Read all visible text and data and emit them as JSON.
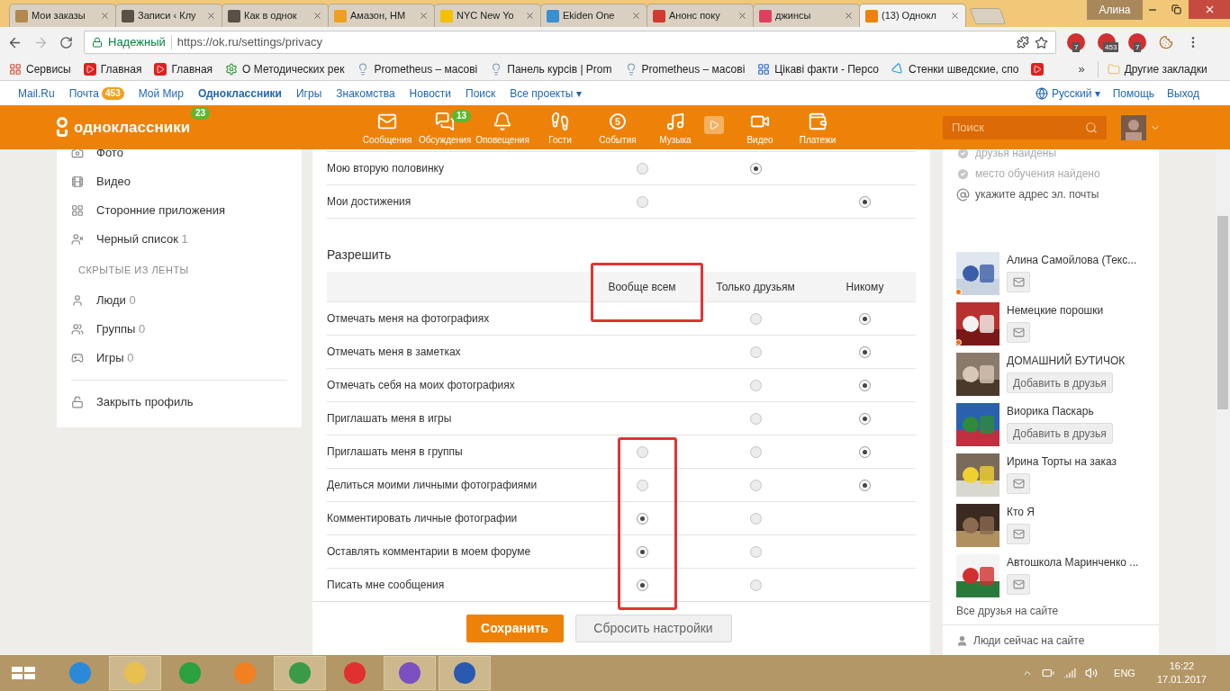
{
  "browser": {
    "tabs": [
      {
        "title": "Мои заказы",
        "selected": false,
        "color": "#b08850"
      },
      {
        "title": "Записи ‹ Клу",
        "selected": false,
        "color": "#5a5048"
      },
      {
        "title": "Как в однок",
        "selected": false,
        "color": "#5a5048"
      },
      {
        "title": "Амазон, НМ",
        "selected": false,
        "color": "#f0a020"
      },
      {
        "title": "NYC New Yo",
        "selected": false,
        "color": "#f5c000"
      },
      {
        "title": "Ekiden One",
        "selected": false,
        "color": "#3a8fd0"
      },
      {
        "title": "Анонс поку",
        "selected": false,
        "color": "#d03a30"
      },
      {
        "title": "джинсы",
        "selected": false,
        "color": "#e04060"
      },
      {
        "title": "(13) Однокл",
        "selected": true,
        "color": "#ee8208"
      }
    ],
    "user": "Алина",
    "secure_label": "Надежный",
    "url": "https://ok.ru/settings/privacy",
    "extension_badges": [
      "7",
      "453",
      "7"
    ],
    "bookmarks": [
      {
        "kind": "apps",
        "label": "Сервисы"
      },
      {
        "kind": "video",
        "label": "Главная"
      },
      {
        "kind": "video",
        "label": "Главная"
      },
      {
        "kind": "gear",
        "label": "О Методических рек"
      },
      {
        "kind": "bulb",
        "label": "Prometheus – масові"
      },
      {
        "kind": "bulb",
        "label": "Панель курсів | Prom"
      },
      {
        "kind": "bulb",
        "label": "Prometheus – масові"
      },
      {
        "kind": "page",
        "label": "Цікаві факти - Персо"
      },
      {
        "kind": "wedge",
        "label": "Стенки шведские, спо"
      }
    ],
    "more": "»",
    "other_bookmarks": "Другие закладки"
  },
  "portal_bar": {
    "items": [
      {
        "label": "Mail.Ru",
        "selected": false
      },
      {
        "label": "Почта",
        "badge": "453",
        "selected": false
      },
      {
        "label": "Мой Мир",
        "selected": false
      },
      {
        "label": "Одноклассники",
        "selected": true
      },
      {
        "label": "Игры",
        "selected": false
      },
      {
        "label": "Знакомства",
        "selected": false
      },
      {
        "label": "Новости",
        "selected": false
      },
      {
        "label": "Поиск",
        "selected": false
      },
      {
        "label": "Все проекты ▾",
        "selected": false
      }
    ],
    "right": [
      "Русский ▾",
      "Помощь",
      "Выход"
    ]
  },
  "header": {
    "logo": "одноклассники",
    "logo_badge": "23",
    "nav": [
      {
        "kind": "mail",
        "label": "Сообщения"
      },
      {
        "kind": "chat",
        "label": "Обсуждения",
        "badge": "13"
      },
      {
        "kind": "bell",
        "label": "Оповещения"
      },
      {
        "kind": "steps",
        "label": "Гости"
      },
      {
        "kind": "events",
        "label": "События",
        "icon_text": "5"
      },
      {
        "kind": "music",
        "label": "Музыка"
      },
      {
        "kind": "camera",
        "label": "Видео"
      },
      {
        "kind": "wallet",
        "label": "Платежи"
      }
    ],
    "search_placeholder": "Поиск"
  },
  "sidebar": {
    "items": [
      {
        "label": "Фото"
      },
      {
        "kind": "video",
        "label": "Видео"
      },
      {
        "kind": "apps",
        "label": "Сторонние приложения"
      },
      {
        "kind": "block",
        "label": "Черный список",
        "count": "1"
      },
      {
        "kind": "heading",
        "label": "СКРЫТЫЕ ИЗ ЛЕНТЫ"
      },
      {
        "kind": "people",
        "label": "Люди",
        "count": "0"
      },
      {
        "kind": "groups",
        "label": "Группы",
        "count": "0"
      },
      {
        "kind": "games",
        "label": "Игры",
        "count": "0"
      },
      {
        "kind": "lock",
        "label": "Закрыть профиль"
      }
    ]
  },
  "show_table": {
    "rows": [
      {
        "label": "Мою вторую половинку",
        "options": [
          {
            "kind": "radio",
            "selected": false
          },
          {
            "kind": "radio",
            "selected": true
          },
          {
            "kind": "empty"
          }
        ]
      },
      {
        "label": "Мои достижения",
        "options": [
          {
            "kind": "radio",
            "selected": false
          },
          {
            "kind": "empty"
          },
          {
            "kind": "radio",
            "selected": true
          }
        ]
      }
    ]
  },
  "allow": {
    "title": "Разрешить",
    "columns": [
      "Вообще всем",
      "Только друзьям",
      "Никому"
    ],
    "rows": [
      {
        "label": "Отмечать меня на фотографиях",
        "options": [
          {
            "kind": "empty"
          },
          {
            "kind": "radio",
            "selected": false
          },
          {
            "kind": "radio",
            "selected": true
          }
        ]
      },
      {
        "label": "Отмечать меня в заметках",
        "options": [
          {
            "kind": "empty"
          },
          {
            "kind": "radio",
            "selected": false
          },
          {
            "kind": "radio",
            "selected": true
          }
        ]
      },
      {
        "label": "Отмечать себя на моих фотографиях",
        "options": [
          {
            "kind": "empty"
          },
          {
            "kind": "radio",
            "selected": false
          },
          {
            "kind": "radio",
            "selected": true
          }
        ]
      },
      {
        "label": "Приглашать меня в игры",
        "options": [
          {
            "kind": "empty"
          },
          {
            "kind": "radio",
            "selected": false
          },
          {
            "kind": "radio",
            "selected": true
          }
        ]
      },
      {
        "label": "Приглашать меня в группы",
        "options": [
          {
            "kind": "radio",
            "selected": false
          },
          {
            "kind": "radio",
            "selected": false
          },
          {
            "kind": "radio",
            "selected": true
          }
        ]
      },
      {
        "label": "Делиться моими личными фотографиями",
        "options": [
          {
            "kind": "radio",
            "selected": false
          },
          {
            "kind": "radio",
            "selected": false
          },
          {
            "kind": "radio",
            "selected": true
          }
        ]
      },
      {
        "label": "Комментировать личные фотографии",
        "options": [
          {
            "kind": "radio",
            "selected": true
          },
          {
            "kind": "radio",
            "selected": false
          },
          {
            "kind": "empty"
          }
        ]
      },
      {
        "label": "Оставлять комментарии в моем форуме",
        "options": [
          {
            "kind": "radio",
            "selected": true
          },
          {
            "kind": "radio",
            "selected": false
          },
          {
            "kind": "empty"
          }
        ]
      },
      {
        "label": "Писать мне сообщения",
        "options": [
          {
            "kind": "radio",
            "selected": true
          },
          {
            "kind": "radio",
            "selected": false
          },
          {
            "kind": "empty"
          }
        ]
      }
    ]
  },
  "buttons": {
    "save": "Сохранить",
    "reset": "Сбросить настройки"
  },
  "profile_checks": [
    {
      "kind": "check",
      "label": "друзья найдены"
    },
    {
      "kind": "check",
      "label": "место обучения найдено"
    },
    {
      "kind": "at",
      "label": "укажите адрес эл. почты"
    }
  ],
  "friends": [
    {
      "name": "Алина Самойлова (Текс...",
      "kind": "message",
      "online": true
    },
    {
      "name": "Немецкие порошки",
      "kind": "message",
      "online": true
    },
    {
      "name": "ДОМАШНИЙ БУТИЧОК",
      "kind": "add",
      "action_label": "Добавить в друзья",
      "online": false
    },
    {
      "name": "Виорика Паскарь",
      "kind": "add",
      "action_label": "Добавить в друзья",
      "online": false
    },
    {
      "name": "Ирина Торты на заказ",
      "kind": "message",
      "online": false
    },
    {
      "name": "Кто Я",
      "kind": "message",
      "online": false
    },
    {
      "name": "Автошкола Маринченко ...",
      "kind": "message",
      "online": false
    }
  ],
  "all_friends": "Все друзья на сайте",
  "people_online": "Люди сейчас на сайте",
  "taskbar": {
    "lang": "ENG",
    "time": "16:22",
    "date": "17.01.2017"
  }
}
